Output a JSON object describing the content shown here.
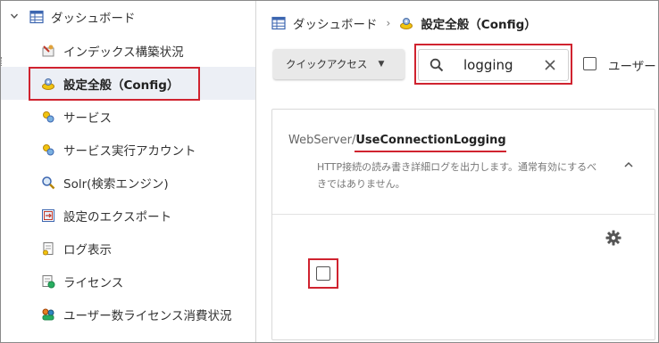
{
  "sidebar": {
    "root": {
      "label": "ダッシュボード",
      "icon": "grid-table-icon"
    },
    "items": [
      {
        "label": "インデックス構築状況",
        "icon": "index-build-icon"
      },
      {
        "label": "設定全般（Config）",
        "icon": "config-settings-icon",
        "active": true
      },
      {
        "label": "サービス",
        "icon": "service-icon"
      },
      {
        "label": "サービス実行アカウント",
        "icon": "service-account-icon"
      },
      {
        "label": "Solr(検索エンジン)",
        "icon": "magnifier-icon"
      },
      {
        "label": "設定のエクスポート",
        "icon": "export-icon"
      },
      {
        "label": "ログ表示",
        "icon": "log-icon"
      },
      {
        "label": "ライセンス",
        "icon": "license-icon"
      },
      {
        "label": "ユーザー数ライセンス消費状況",
        "icon": "users-license-icon"
      }
    ]
  },
  "breadcrumb": {
    "home": "ダッシュボード",
    "separator": "›",
    "current": "設定全般（Config）"
  },
  "toolbar": {
    "quick_access_label": "クイックアクセス",
    "search_value": "logging",
    "user_filter_label": "ユーザー"
  },
  "setting": {
    "key_prefix": "WebServer/",
    "key_name": "UseConnectionLogging",
    "description": "HTTP接続の読み書き詳細ログを出力します。通常有効にするべきではありません。",
    "value_checked": false
  },
  "colors": {
    "annotation_red": "#d0232f",
    "active_bg": "#eceff5"
  }
}
